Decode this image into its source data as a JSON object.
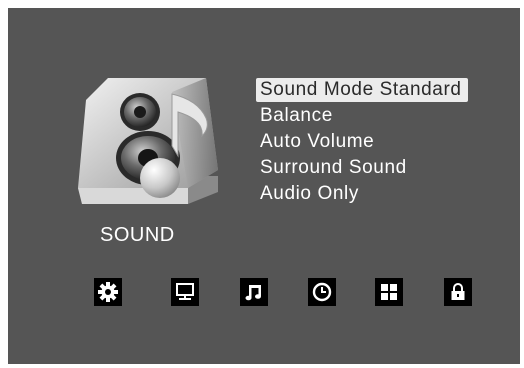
{
  "menu": {
    "category_label": "SOUND",
    "items": [
      {
        "label": "Sound Mode Standard",
        "selected": true
      },
      {
        "label": "Balance",
        "selected": false
      },
      {
        "label": "Auto Volume",
        "selected": false
      },
      {
        "label": "Surround Sound",
        "selected": false
      },
      {
        "label": "Audio Only",
        "selected": false
      }
    ]
  },
  "bottom_icons": [
    "gear-icon",
    "monitor-icon",
    "music-note-icon",
    "clock-icon",
    "grid-icon",
    "lock-icon"
  ],
  "colors": {
    "background": "#555555",
    "text": "#ffffff",
    "selected_bg": "#ececec",
    "selected_text": "#2a2a2a",
    "icon_bg": "#000000"
  }
}
